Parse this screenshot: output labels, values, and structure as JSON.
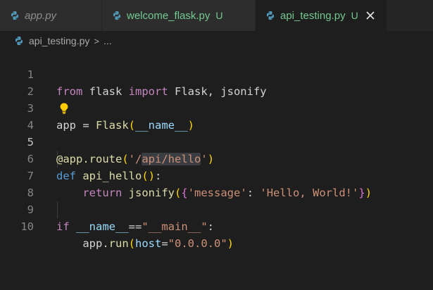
{
  "tabs": [
    {
      "label": "app.py",
      "badge": "",
      "active": false
    },
    {
      "label": "welcome_flask.py",
      "badge": "U",
      "active": false
    },
    {
      "label": "api_testing.py",
      "badge": "U",
      "active": true
    }
  ],
  "breadcrumb": {
    "file": "api_testing.py",
    "separator": ">",
    "trail": "..."
  },
  "code": {
    "line_numbers": [
      "1",
      "2",
      "3",
      "4",
      "5",
      "6",
      "7",
      "8",
      "9",
      "10"
    ],
    "active_line": "5",
    "lines": {
      "l1": {
        "k1": "from",
        "t1": " flask ",
        "k2": "import",
        "t2": " Flask, jsonify"
      },
      "l3": {
        "t1": "app = ",
        "f1": "Flask",
        "b1": "(",
        "v1": "__name__",
        "b2": ")"
      },
      "l5": {
        "f1": "@app.route",
        "b1": "(",
        "s1": "'/",
        "s2": "api/hello",
        "s3": "'",
        "b2": ")"
      },
      "l6": {
        "k1": "def",
        "t1": " ",
        "f1": "api_hello",
        "b1": "(",
        "b2": ")",
        "t2": ":"
      },
      "l7": {
        "ind": "    ",
        "k1": "return",
        "t1": " ",
        "f1": "jsonify",
        "b1": "(",
        "b2": "{",
        "s1": "'message'",
        "t2": ": ",
        "s2": "'Hello, World!'",
        "b3": "}",
        "b4": ")"
      },
      "l9": {
        "k1": "if",
        "t1": " ",
        "v1": "__name__",
        "t2": "==",
        "s1": "\"__main__\"",
        "t3": ":"
      },
      "l10": {
        "ind": "    ",
        "t1": "app.",
        "f1": "run",
        "b1": "(",
        "v1": "host",
        "t2": "=",
        "s1": "\"0.0.0.0\"",
        "b2": ")"
      }
    }
  },
  "colors": {
    "background": "#1e1e1e",
    "tab_bar": "#252526",
    "untracked": "#73c991",
    "keyword": "#569cd6",
    "control_keyword": "#c586c0",
    "function": "#dcdcaa",
    "variable": "#9cdcfe",
    "string": "#ce9178"
  },
  "icons": {
    "tab": "python-icon",
    "close": "close-icon",
    "lightbulb": "lightbulb-icon"
  }
}
